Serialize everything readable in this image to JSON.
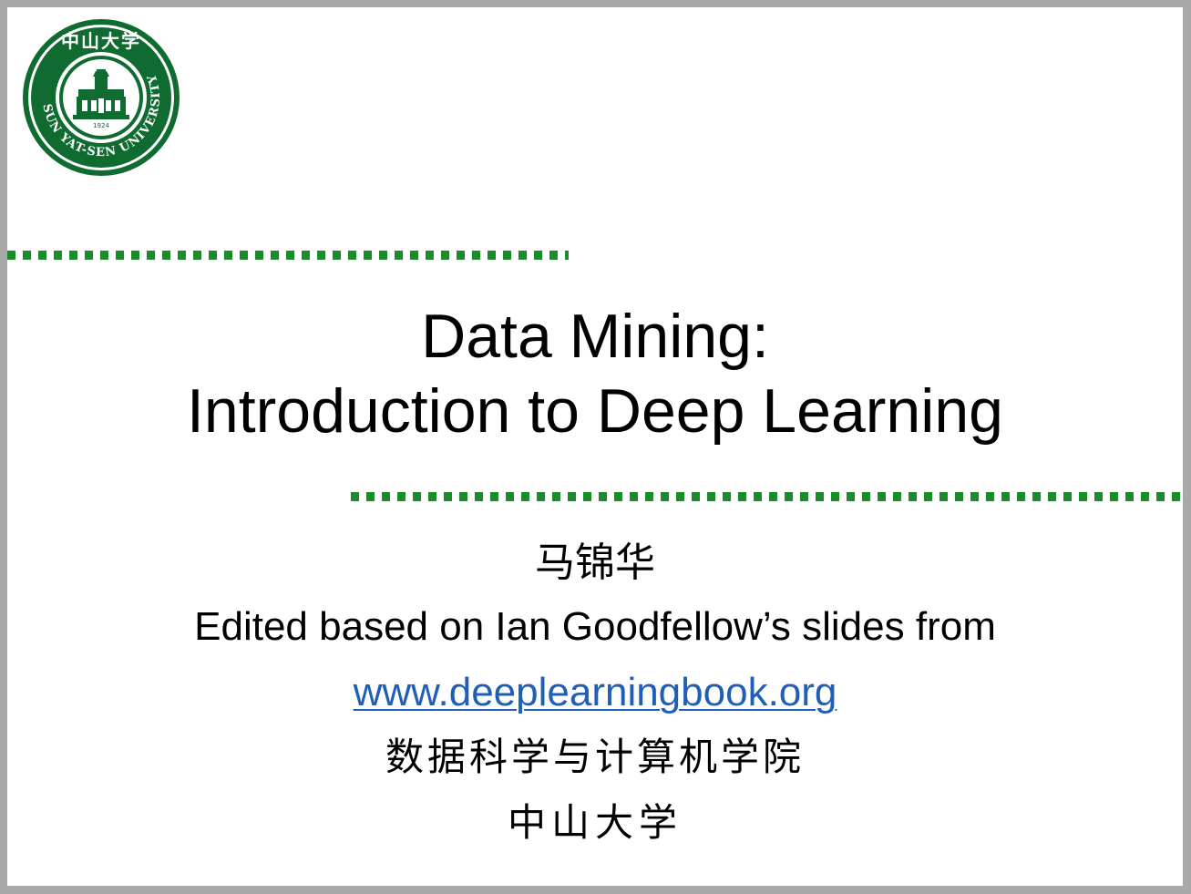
{
  "slide": {
    "logo": {
      "top_text": "中山大学",
      "ring_text": "SUN YAT-SEN UNIVERSITY",
      "year": "1924",
      "color": "#0f6b2f"
    },
    "title_line1": "Data Mining:",
    "title_line2": "Introduction to Deep Learning",
    "author": "马锦华",
    "edited_text": "Edited based on Ian Goodfellow’s slides from",
    "link_text": "www.deeplearningbook.org",
    "school": "数据科学与计算机学院",
    "university": "中山大学"
  },
  "colors": {
    "accent_dots": "#1a8c2a",
    "link": "#1f5fb8",
    "frame": "#a9a9a9"
  }
}
